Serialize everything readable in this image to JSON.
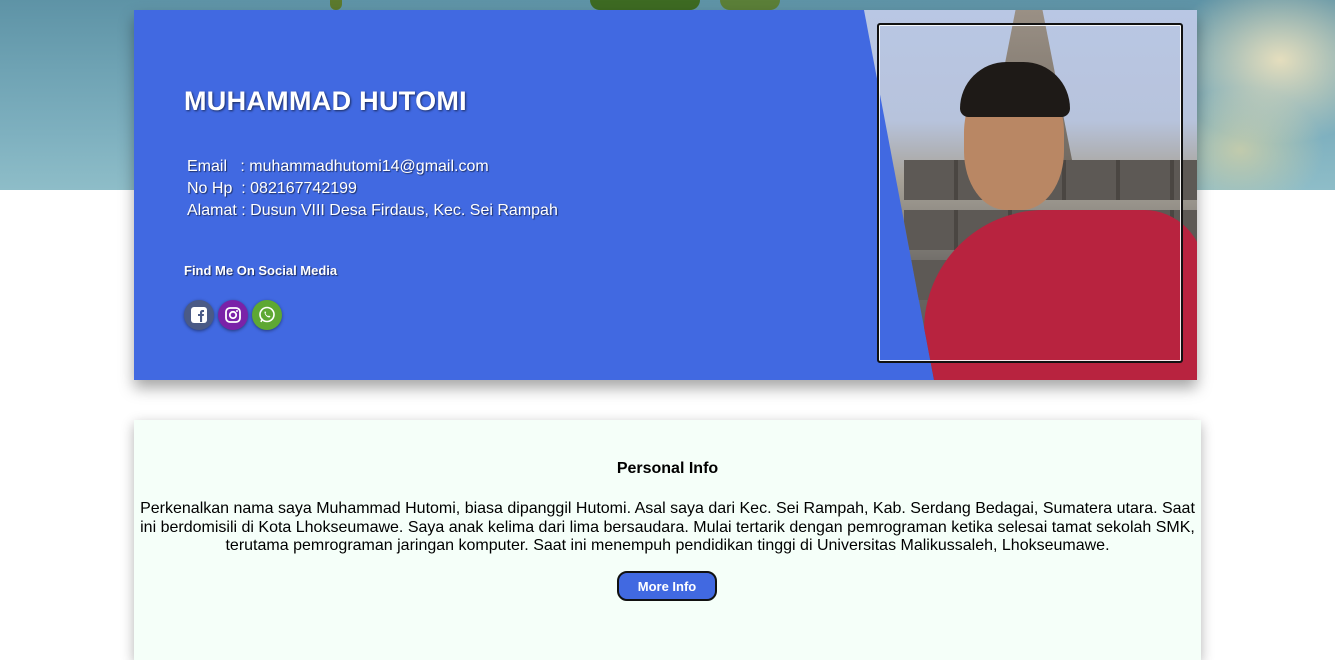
{
  "profile": {
    "name": "MUHAMMAD HUTOMI",
    "contact": [
      {
        "label": "Email",
        "sep": "   : ",
        "value": "muhammadhutomi14@gmail.com"
      },
      {
        "label": "No Hp",
        "sep": "  : ",
        "value": "082167742199"
      },
      {
        "label": "Alamat",
        "sep": " : ",
        "value": "Dusun VIII Desa Firdaus, Kec. Sei Rampah"
      }
    ],
    "social_title": "Find Me On Social Media",
    "social_icons": [
      "facebook-icon",
      "instagram-icon",
      "whatsapp-icon"
    ],
    "photo": "profile-photo"
  },
  "info": {
    "title": "Personal Info",
    "text": "Perkenalkan nama saya Muhammad Hutomi, biasa dipanggil Hutomi. Asal saya dari Kec. Sei Rampah, Kab. Serdang Bedagai, Sumatera utara. Saat ini berdomisili di Kota Lhokseumawe. Saya anak kelima dari lima bersaudara. Mulai tertarik dengan pemrograman ketika selesai tamat sekolah SMK, terutama pemrograman jaringan komputer. Saat ini menempuh pendidikan tinggi di Universitas Malikussaleh, Lhokseumawe.",
    "button_label": "More Info"
  },
  "colors": {
    "card_blue": "#4169e1",
    "info_bg": "#f5fff9"
  }
}
